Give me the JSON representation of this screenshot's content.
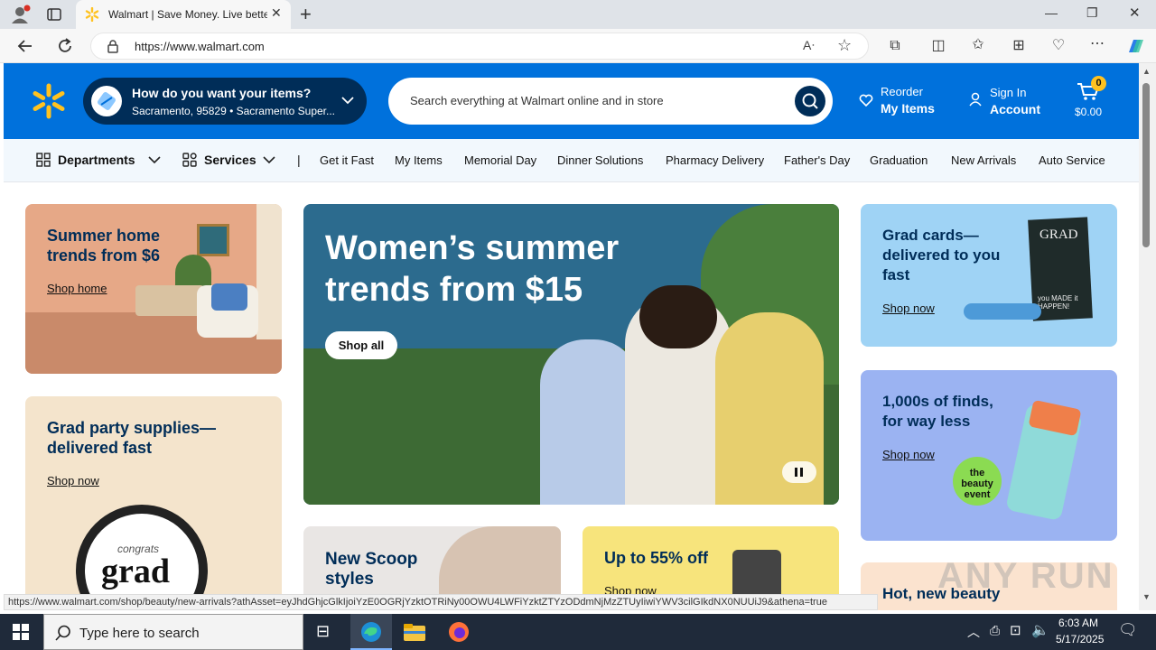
{
  "browser": {
    "tab_title": "Walmart | Save Money. Live bette",
    "url": "https://www.walmart.com",
    "new_tab_glyph": "+",
    "window_controls": {
      "minimize": "—",
      "restore": "❐",
      "close": "✕"
    }
  },
  "header": {
    "delivery_title": "How do you want your items?",
    "delivery_location": "Sacramento, 95829 • Sacramento Super...",
    "search_placeholder": "Search everything at Walmart online and in store",
    "reorder_small": "Reorder",
    "reorder_big": "My Items",
    "signin_small": "Sign In",
    "signin_big": "Account",
    "cart_count": "0",
    "cart_total": "$0.00",
    "brand_color": "#0071dc",
    "spark_color": "#ffc220"
  },
  "nav": {
    "departments": "Departments",
    "services": "Services",
    "divider": "|",
    "links": [
      "Get it Fast",
      "My Items",
      "Memorial Day",
      "Dinner Solutions",
      "Pharmacy Delivery",
      "Father's Day",
      "Graduation",
      "New Arrivals",
      "Auto Service"
    ]
  },
  "cards": {
    "summer_home": {
      "title": "Summer home trends from $6",
      "link": "Shop home"
    },
    "grad_party": {
      "title": "Grad party supplies—delivered fast",
      "link": "Shop now",
      "plate_text_small": "congrats",
      "plate_text_big": "grad"
    },
    "hero": {
      "title": "Women’s summer trends from $15",
      "button": "Shop all"
    },
    "grad_cards": {
      "title": "Grad cards—delivered to you fast",
      "link": "Shop now",
      "card_art_top": "GRAD",
      "card_art_bottom": "you MADE it HAPPEN!"
    },
    "finds": {
      "title": "1,000s of finds, for way less",
      "link": "Shop now",
      "badge": "the beauty event"
    },
    "new_scoop": {
      "title": "New Scoop styles"
    },
    "off55": {
      "title": "Up to 55% off",
      "link": "Shop now"
    },
    "beauty": {
      "title": "Hot, new beauty"
    }
  },
  "status_url": "https://www.walmart.com/shop/beauty/new-arrivals?athAsset=eyJhdGhjcGlkIjoiYzE0OGRjYzktOTRiNy00OWU4LWFiYzktZTYzODdmNjMzZTUyIiwiYWV3cilGIkdNX0NUUiJ9&athena=true",
  "watermark": "ANY RUN",
  "taskbar": {
    "search_placeholder": "Type here to search",
    "time": "6:03 AM",
    "date": "5/17/2025"
  }
}
